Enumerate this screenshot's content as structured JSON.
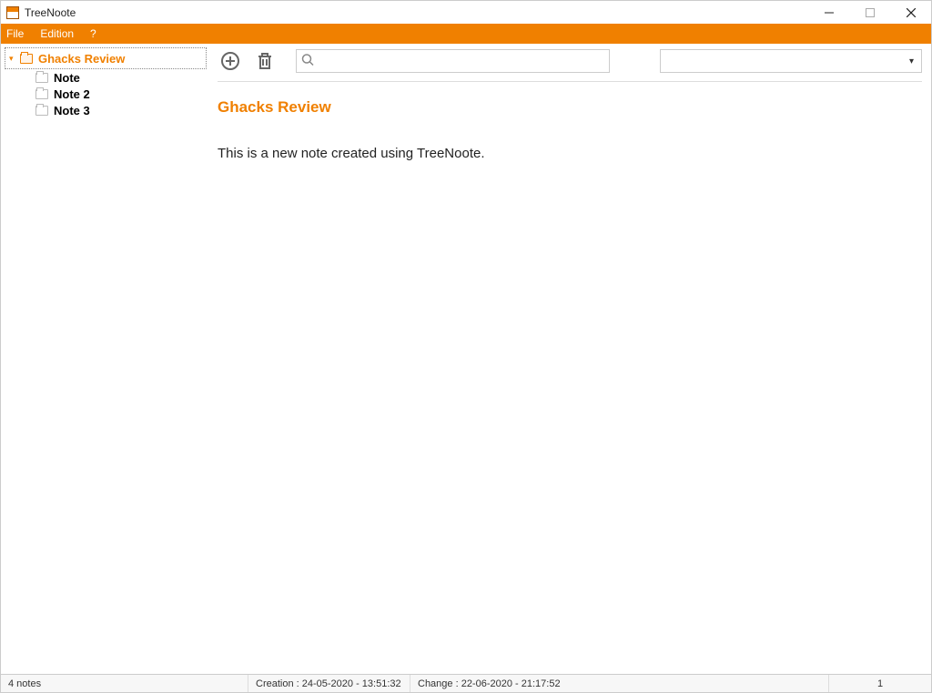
{
  "window": {
    "title": "TreeNoote"
  },
  "menu": {
    "file": "File",
    "edition": "Edition",
    "help": "?"
  },
  "tree": {
    "root": {
      "label": "Ghacks Review",
      "children": [
        {
          "label": "Note"
        },
        {
          "label": "Note 2"
        },
        {
          "label": "Note 3"
        }
      ]
    }
  },
  "toolbar": {
    "search_placeholder": ""
  },
  "note": {
    "title": "Ghacks Review",
    "body": "This is a new note created using TreeNoote."
  },
  "status": {
    "notes_count": "4  notes",
    "creation": "Creation : 24-05-2020 - 13:51:32",
    "change": "Change : 22-06-2020 - 21:17:52",
    "right_count": "1"
  }
}
